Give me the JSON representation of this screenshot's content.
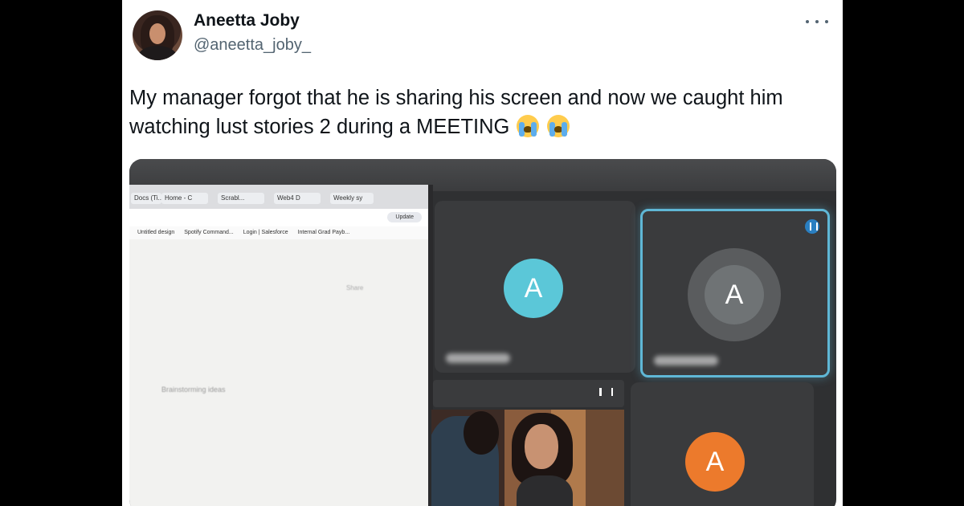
{
  "tweet": {
    "display_name": "Aneetta Joby",
    "handle": "@aneetta_joby_",
    "text": "My manager forgot that he is sharing his screen and now we caught him watching lust stories 2 during a MEETING",
    "emojis": [
      "loudly-crying-face-icon",
      "loudly-crying-face-icon"
    ]
  },
  "screen": {
    "browser": {
      "tabs": [
        "Docs (Ti..",
        "Home - C",
        "Scrabl...",
        "Web4 D",
        "Weekly sy"
      ],
      "update_label": "Update",
      "bookmarks": [
        "Untitled design",
        "Spotify Command...",
        "Login | Salesforce",
        "Internal Grad Payb..."
      ],
      "doc_share_label": "Share",
      "doc_hint": "Brainstorming ideas"
    },
    "meeting_tiles": [
      {
        "initial": "A",
        "color": "#5bc7d8"
      },
      {
        "initial": "A",
        "color": "#6f7375",
        "active": true
      },
      {
        "initial": "A",
        "color": "#ec7a2c"
      }
    ],
    "accent_colors": {
      "active_border": "#5fb7d6",
      "pin": "#2a7fc1"
    }
  }
}
